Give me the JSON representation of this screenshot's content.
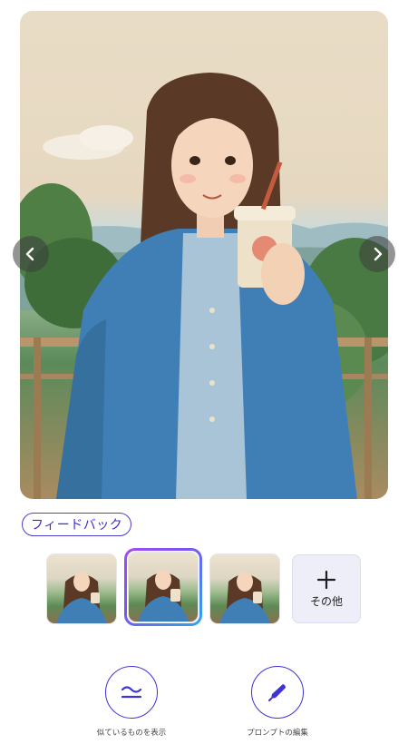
{
  "feedback": {
    "label": "フィードバック"
  },
  "more": {
    "label": "その他",
    "icon": "plus-icon"
  },
  "actions": [
    {
      "label": "似ているものを表示",
      "icon": "approx-equal-icon"
    },
    {
      "label": "プロンプトの編集",
      "icon": "pen-icon"
    }
  ],
  "thumbnails": {
    "count": 3,
    "selected_index": 1
  },
  "colors": {
    "accent": "#3d33d6",
    "selection_gradient_start": "#a64cf0",
    "selection_gradient_end": "#2aa7ef",
    "more_tile_bg": "#eeeef9"
  }
}
